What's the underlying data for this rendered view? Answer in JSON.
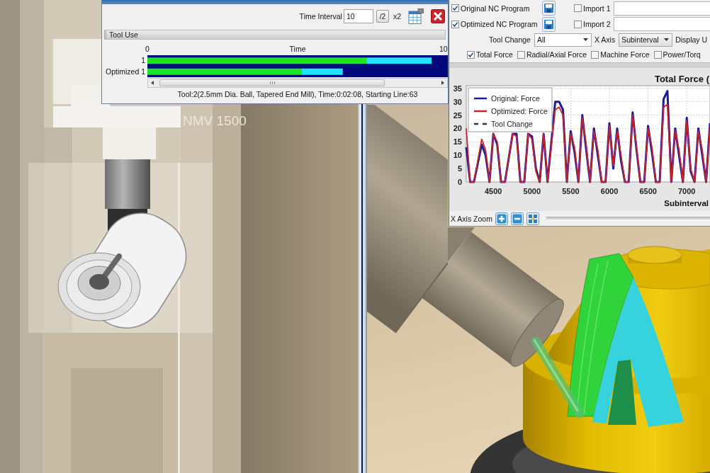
{
  "graph_window": {
    "time_interval": {
      "label": "Time Interval",
      "value": "10"
    },
    "halve_button": "/2",
    "double_button": "x2",
    "section_title": "Tool Use",
    "tool_use": {
      "chart_data": {
        "type": "bar",
        "orientation": "horizontal",
        "stacked": true,
        "xlabel": "Time",
        "categories": [
          "1",
          "Optimized 1"
        ],
        "series": [
          {
            "color": "#1ee61e",
            "values": [
              7.4,
              5.2
            ]
          },
          {
            "color": "#22e4ff",
            "values": [
              2.2,
              1.4
            ]
          }
        ],
        "xlim": [
          0,
          10.15
        ],
        "xticks": [
          0,
          10
        ]
      }
    },
    "status": "Tool:2(2.5mm Dia. Ball, Tapered End Mill), Time:0:02:08, Starting Line:63"
  },
  "force_panel": {
    "programs": [
      {
        "label": "Original NC Program",
        "checked": true,
        "import_label": "Import 1",
        "import_checked": false
      },
      {
        "label": "Optimized NC Program",
        "checked": true,
        "import_label": "Import 2",
        "import_checked": false
      }
    ],
    "tool_change": {
      "label": "Tool Change",
      "value": "All"
    },
    "x_axis": {
      "label": "X Axis",
      "value": "Subinterval"
    },
    "display_label": "Display U",
    "force_types": [
      {
        "label": "Total Force",
        "checked": true
      },
      {
        "label": "Radial/Axial Force",
        "checked": false
      },
      {
        "label": "Machine Force",
        "checked": false
      },
      {
        "label": "Power/Torq",
        "checked": false
      }
    ],
    "chart": {
      "chart_data": {
        "type": "line",
        "title": "Total Force (",
        "xlabel": "Subinterval",
        "x": [
          4150,
          4200,
          4250,
          4350,
          4400,
          4450,
          4500,
          4550,
          4600,
          4650,
          4750,
          4800,
          4850,
          4900,
          4950,
          5000,
          5050,
          5100,
          5150,
          5200,
          5300,
          5350,
          5400,
          5450,
          5500,
          5550,
          5600,
          5650,
          5700,
          5750,
          5800,
          5850,
          5900,
          5950,
          6000,
          6050,
          6100,
          6150,
          6200,
          6250,
          6300,
          6350,
          6400,
          6450,
          6500,
          6550,
          6600,
          6650,
          6700,
          6750,
          6800,
          6850,
          6900,
          6950,
          7000,
          7050,
          7100,
          7150,
          7200,
          7250,
          7300
        ],
        "series": [
          {
            "name": "Original: Force",
            "color": "#1c1c96",
            "values": [
              13,
              0,
              0,
              14,
              10,
              0,
              18,
              14,
              0,
              0,
              18,
              18,
              0,
              0,
              18,
              17,
              5,
              0,
              18,
              0,
              30,
              30,
              27,
              0,
              19,
              11,
              0,
              25,
              12,
              0,
              20,
              10,
              0,
              0,
              22,
              5,
              20,
              8,
              0,
              0,
              26,
              12,
              0,
              0,
              21,
              11,
              0,
              0,
              31,
              34,
              0,
              20,
              10,
              0,
              24,
              4,
              0,
              20,
              10,
              0,
              22
            ]
          },
          {
            "name": "Optimized: Force",
            "color": "#cc2229",
            "values": [
              20,
              0,
              0,
              16,
              12,
              0,
              18,
              15,
              0,
              0,
              18,
              17,
              0,
              0,
              18,
              16,
              4,
              0,
              18,
              0,
              27,
              28,
              25,
              0,
              18,
              13,
              0,
              24,
              14,
              0,
              19,
              12,
              0,
              0,
              21,
              6,
              19,
              10,
              0,
              0,
              25,
              13,
              0,
              0,
              20,
              13,
              0,
              0,
              28,
              29,
              0,
              19,
              12,
              0,
              23,
              5,
              0,
              19,
              12,
              0,
              21
            ]
          }
        ],
        "xlim": [
          4150,
          7300
        ],
        "ylim": [
          0,
          36
        ],
        "xticks": [
          4500,
          5000,
          5500,
          6000,
          6500,
          7000
        ],
        "yticks": [
          0,
          5,
          10,
          15,
          20,
          25,
          30,
          35
        ],
        "grid": true,
        "legend": true
      },
      "legend_extra": [
        {
          "label": "Tool Change",
          "color": "#333333"
        }
      ]
    },
    "zoom_label": "X Axis Zoom"
  },
  "left_viewport": {
    "machine_label": "NMV 1500"
  }
}
